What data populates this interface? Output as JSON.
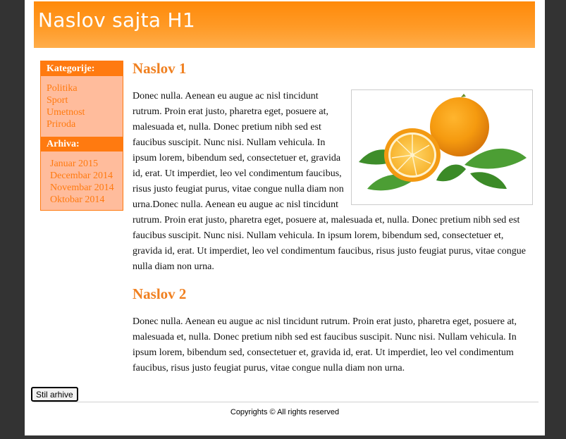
{
  "header": {
    "title": "Naslov sajta H1"
  },
  "sidebar": {
    "categories_heading": "Kategorije:",
    "categories": [
      "Politika",
      "Sport",
      "Umetnost",
      "Priroda"
    ],
    "archive_heading": "Arhiva:",
    "archive": [
      "Januar 2015",
      "Decembar 2014",
      "Novembar 2014",
      "Oktobar 2014"
    ]
  },
  "article1": {
    "heading": "Naslov 1",
    "image_alt": "orange-fruit",
    "text": "Donec nulla. Aenean eu augue ac nisl tincidunt rutrum. Proin erat justo, pharetra eget, posuere at, malesuada et, nulla. Donec pretium nibh sed est faucibus suscipit. Nunc nisi. Nullam vehicula. In ipsum lorem, bibendum sed, consectetuer et, gravida id, erat. Ut imperdiet, leo vel condimentum faucibus, risus justo feugiat purus, vitae congue nulla diam non urna.Donec nulla. Aenean eu augue ac nisl tincidunt rutrum. Proin erat justo, pharetra eget, posuere at, malesuada et, nulla. Donec pretium nibh sed est faucibus suscipit. Nunc nisi. Nullam vehicula. In ipsum lorem, bibendum sed, consectetuer et, gravida id, erat. Ut imperdiet, leo vel condimentum faucibus, risus justo feugiat purus, vitae congue nulla diam non urna."
  },
  "article2": {
    "heading": "Naslov 2",
    "text": "Donec nulla. Aenean eu augue ac nisl tincidunt rutrum. Proin erat justo, pharetra eget, posuere at, malesuada et, nulla. Donec pretium nibh sed est faucibus suscipit. Nunc nisi. Nullam vehicula. In ipsum lorem, bibendum sed, consectetuer et, gravida id, erat. Ut imperdiet, leo vel condimentum faucibus, risus justo feugiat purus, vitae congue nulla diam non urna."
  },
  "buttons": {
    "style_archive": "Stil arhive"
  },
  "footer": {
    "copyright": "Copyrights © All rights reserved"
  },
  "colors": {
    "page_background": "#333333",
    "header_orange": "#ff8a0a",
    "sidebar_background": "#ffbc9c",
    "accent": "#ff7a10",
    "heading": "#f08020"
  }
}
